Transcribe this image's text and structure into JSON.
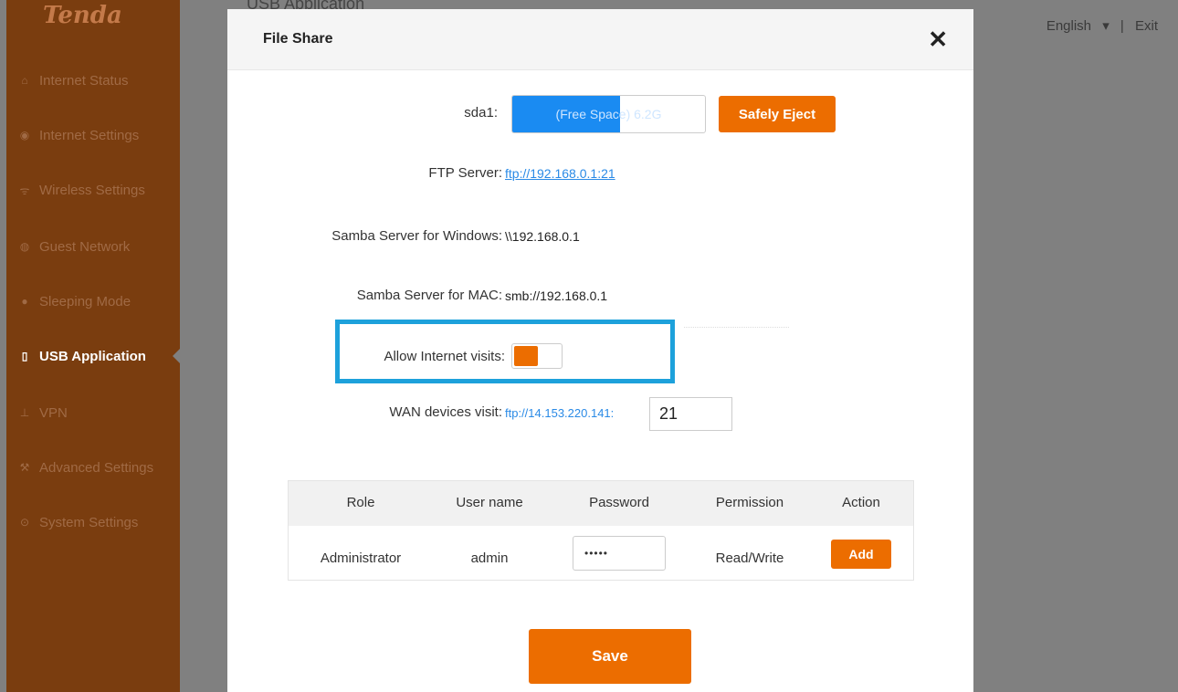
{
  "sidebar": {
    "logo": "Tenda",
    "items": [
      {
        "icon": "house-icon",
        "glyph": "⌂",
        "label": "Internet Status"
      },
      {
        "icon": "globe-icon",
        "glyph": "◉",
        "label": "Internet Settings"
      },
      {
        "icon": "wifi-icon",
        "glyph": "ᯤ",
        "label": "Wireless Settings"
      },
      {
        "icon": "guest-icon",
        "glyph": "◍",
        "label": "Guest Network"
      },
      {
        "icon": "bulb-icon",
        "glyph": "●",
        "label": "Sleeping Mode"
      },
      {
        "icon": "usb-icon",
        "glyph": "▯",
        "label": "USB Application"
      },
      {
        "icon": "vpn-icon",
        "glyph": "⊥",
        "label": "VPN"
      },
      {
        "icon": "wrench-icon",
        "glyph": "⚒",
        "label": "Advanced Settings"
      },
      {
        "icon": "gear-icon",
        "glyph": "⊙",
        "label": "System Settings"
      }
    ]
  },
  "header": {
    "page_title": "USB Application",
    "language": "English",
    "language_caret": "▾",
    "separator": "|",
    "exit": "Exit"
  },
  "modal": {
    "title": "File Share",
    "close_glyph": "✕",
    "disk": {
      "label": "sda1:",
      "space_text": "(Free Space) 6.2G",
      "used_fraction": 0.56
    },
    "eject_label": "Safely Eject",
    "ftp": {
      "label": "FTP Server:",
      "value": "ftp://192.168.0.1:21"
    },
    "samba_windows": {
      "label": "Samba Server for Windows:",
      "value": "\\\\192.168.0.1"
    },
    "samba_mac": {
      "label": "Samba Server for MAC:",
      "value": "smb://192.168.0.1"
    },
    "allow_internet": {
      "label": "Allow Internet visits:",
      "enabled": true
    },
    "wan": {
      "label": "WAN devices visit:",
      "value": "ftp://14.153.220.141:",
      "port": "21"
    },
    "table": {
      "headers": [
        "Role",
        "User name",
        "Password",
        "Permission",
        "Action"
      ],
      "row": {
        "role": "Administrator",
        "username": "admin",
        "password": "•••••",
        "permission": "Read/Write",
        "action": "Add"
      }
    },
    "save_label": "Save"
  },
  "colors": {
    "accent": "#ec6d00",
    "sidebar": "#7a3d0f",
    "highlight": "#1da1db",
    "link": "#2a8ae6"
  }
}
